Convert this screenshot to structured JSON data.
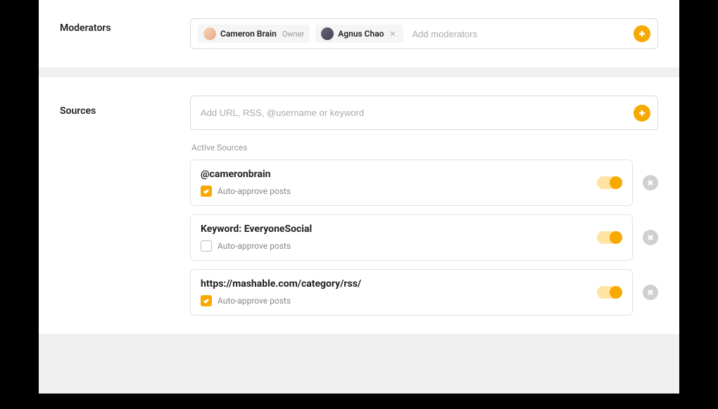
{
  "sections": {
    "moderators": {
      "label": "Moderators",
      "input_placeholder": "Add moderators",
      "people": [
        {
          "name": "Cameron Brain",
          "role": "Owner",
          "removable": false
        },
        {
          "name": "Agnus Chao",
          "role": "",
          "removable": true
        }
      ]
    },
    "sources": {
      "label": "Sources",
      "input_placeholder": "Add URL, RSS, @username or keyword",
      "active_heading": "Active Sources",
      "auto_approve_label": "Auto-approve posts",
      "items": [
        {
          "title": "@cameronbrain",
          "auto_approve": true,
          "enabled": true
        },
        {
          "title": "Keyword: EveryoneSocial",
          "auto_approve": false,
          "enabled": true
        },
        {
          "title": "https://mashable.com/category/rss/",
          "auto_approve": true,
          "enabled": true
        }
      ]
    }
  },
  "colors": {
    "accent": "#f7a900"
  }
}
